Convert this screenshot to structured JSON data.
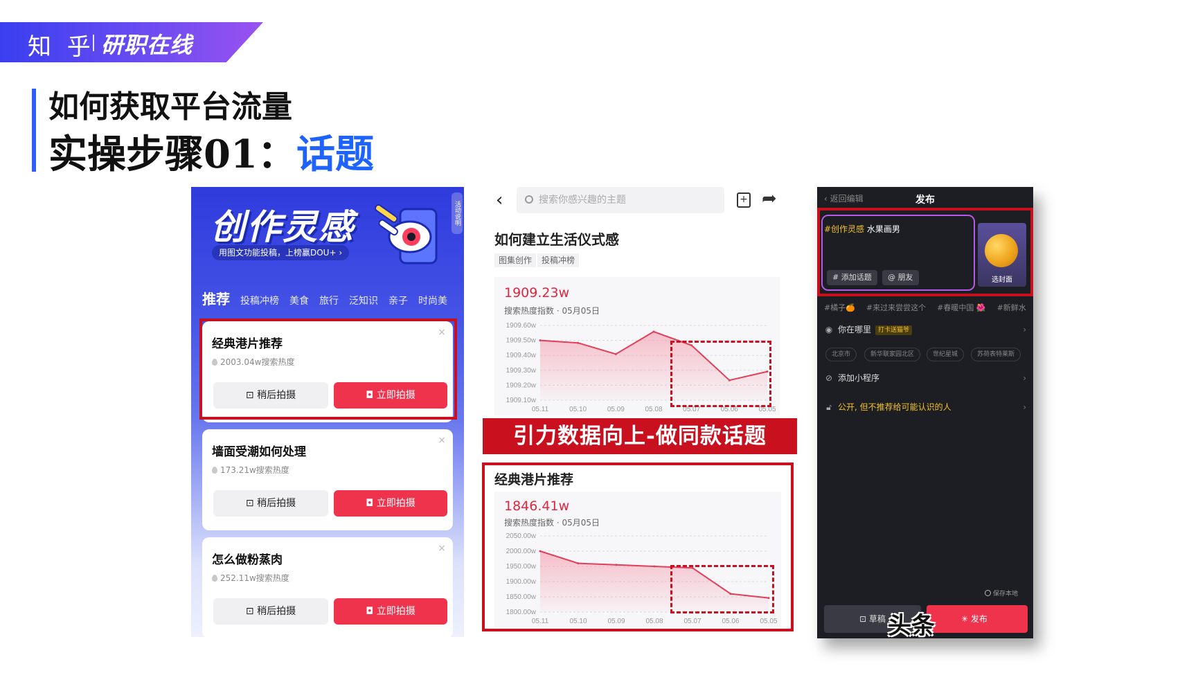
{
  "banner": {
    "zhihu": "知 乎",
    "brand": "研职在线"
  },
  "titles": {
    "line1": "如何获取平台流量",
    "line2_prefix": "实操步骤01：",
    "line2_highlight": "话题"
  },
  "phone1": {
    "hero": "创作灵感",
    "subtitle": "用图文功能投稿，上榜赢DOU+ ›",
    "side_label": "活动说明",
    "tabs": [
      "推荐",
      "投稿冲榜",
      "美食",
      "旅行",
      "泛知识",
      "亲子",
      "时尚美"
    ],
    "later_label": "⊡ 稍后拍摄",
    "now_label": "◘ 立即拍摄",
    "close_glyph": "×",
    "cards": [
      {
        "title": "经典港片推荐",
        "heat": "2003.04w搜索热度"
      },
      {
        "title": "墙面受潮如何处理",
        "heat": "173.21w搜索热度"
      },
      {
        "title": "怎么做粉蒸肉",
        "heat": "252.11w搜索热度"
      }
    ]
  },
  "phone2": {
    "back_glyph": "‹",
    "search_placeholder": "搜索你感兴趣的主题",
    "save_glyph": "+",
    "share_glyph": "➦",
    "topic_title": "如何建立生活仪式感",
    "tags": [
      "图集创作",
      "投稿冲榜"
    ],
    "chart1_value": "1909.23w",
    "chart1_caption": "搜索热度指数 · 05月05日",
    "banner_text": "引力数据向上-做同款话题",
    "chart2_title": "经典港片推荐",
    "chart2_value": "1846.41w",
    "chart2_caption": "搜索热度指数 · 05月05日"
  },
  "phone3": {
    "back_label": "‹ 返回编辑",
    "title": "发布",
    "tag_text": "#创作灵感",
    "body_text": " 水果画男",
    "chip_topic": "# 添加话题",
    "chip_friend": "@ 朋友",
    "cover_label": "选封面",
    "hashtags": [
      "#橘子🍊",
      "#来过来尝尝这个",
      "#春暖中国 🌺",
      "#新鲜水"
    ],
    "location_label": "你在哪里",
    "location_badge": "打卡送猫爷",
    "locations": [
      "北京市",
      "新华联家园北区",
      "世纪星城",
      "苏荷表特莱斯"
    ],
    "miniprogram_label": "添加小程序",
    "privacy_label": "公开, 但不推荐给可能认识的人",
    "save_local": "保存本地",
    "draft_label": "⊡ 草稿",
    "publish_label": "✳ 发布",
    "watermark": "头条"
  },
  "chart_data": [
    {
      "type": "line",
      "title": "如何建立生活仪式感",
      "ylabel": "搜索热度指数",
      "categories": [
        "05.11",
        "05.10",
        "05.09",
        "05.08",
        "05.07",
        "05.06",
        "05.05"
      ],
      "series": [
        {
          "values": [
            1909.48,
            1909.46,
            1909.37,
            1909.55,
            1909.44,
            1909.16,
            1909.23
          ]
        }
      ],
      "ylim": [
        1909.0,
        1909.6
      ],
      "yticks": [
        "1909.60w",
        "1909.50w",
        "1909.40w",
        "1909.30w",
        "1909.20w",
        "1909.10w"
      ],
      "grid": true
    },
    {
      "type": "line",
      "title": "经典港片推荐",
      "ylabel": "搜索热度指数",
      "categories": [
        "05.11",
        "05.10",
        "05.09",
        "05.08",
        "05.07",
        "05.06",
        "05.05"
      ],
      "series": [
        {
          "values": [
            2000,
            1960,
            1955,
            1950,
            1945,
            1860,
            1846.41
          ]
        }
      ],
      "ylim": [
        1800,
        2050
      ],
      "yticks": [
        "2050.00w",
        "2000.00w",
        "1950.00w",
        "1900.00w",
        "1850.00w",
        "1800.00w"
      ],
      "grid": true
    }
  ]
}
